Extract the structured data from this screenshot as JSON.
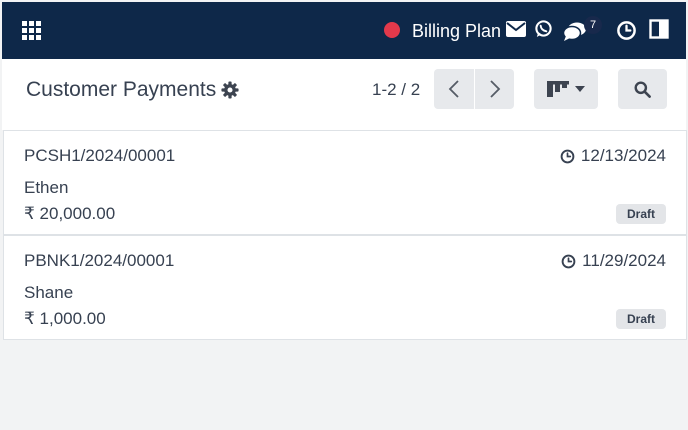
{
  "colors": {
    "navbar_bg": "#0e2849",
    "status_dot": "#e2394b",
    "button_bg": "#e7e9ec",
    "badge_bg": "#e3e5e8"
  },
  "navbar": {
    "apps_icon": "grid-icon",
    "plan_label": "Billing Plan",
    "icons": [
      "envelope-icon",
      "whatsapp-icon",
      "chat-icon",
      "clock-icon",
      "split-panel-icon"
    ],
    "messages_count": "7"
  },
  "control_panel": {
    "title": "Customer Payments",
    "pager": "1-2 / 2"
  },
  "records": [
    {
      "ref": "PCSH1/2024/00001",
      "date": "12/13/2024",
      "partner": "Ethen",
      "amount": "₹ 20,000.00",
      "state": "Draft"
    },
    {
      "ref": "PBNK1/2024/00001",
      "date": "11/29/2024",
      "partner": "Shane",
      "amount": "₹ 1,000.00",
      "state": "Draft"
    }
  ]
}
